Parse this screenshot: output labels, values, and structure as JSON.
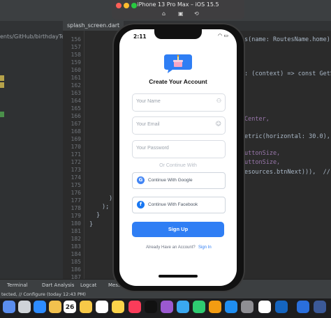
{
  "simulator": {
    "title": "iPhone 13 Pro Max – iOS 15.5"
  },
  "ide": {
    "tab_label": "splash_screen.dart",
    "left_panel_text": "ents/GitHub/birthdayTexter#",
    "line_numbers": [
      "156",
      "157",
      "158",
      "159",
      "160",
      "161",
      "162",
      "163",
      "164",
      "165",
      "166",
      "167",
      "168",
      "169",
      "170",
      "171",
      "172",
      "173",
      "174",
      "175",
      "176",
      "177",
      "178",
      "179",
      "180",
      "181",
      "182",
      "183",
      "184",
      "185",
      "186",
      "187"
    ],
    "code": {
      "l156": "s(name: RoutesName.home)),",
      "l159": ": (context) => const GetSta",
      "l163": "Center,",
      "l165": "etric(horizontal: 30.0),",
      "l167": "uttonSize,",
      "l168": "uttonSize,",
      "l169": "esources.btnNext))),  // Co",
      "l172": "),",
      "l173": ");",
      "l174": "}",
      "l175": "}"
    },
    "bottom_tabs": [
      "Terminal",
      "Dart Analysis",
      "Logcat",
      "Messag"
    ],
    "status": "tected, // Configure (today 12:43 PM)",
    "dock_badge": "26"
  },
  "app": {
    "time": "2:11",
    "title": "Create Your Account",
    "name_placeholder": "Your Name",
    "email_placeholder": "Your Email",
    "password_placeholder": "Your Password",
    "or_text": "Or Continue With",
    "google_label": "Continue With Google",
    "facebook_label": "Continue With Facebook",
    "signup_label": "Sign Up",
    "already_text": "Already Have an Account?",
    "signin_text": "Sign In"
  },
  "colors": {
    "accent": "#2f7ef4",
    "logo_bubble": "#2f7ef4"
  }
}
